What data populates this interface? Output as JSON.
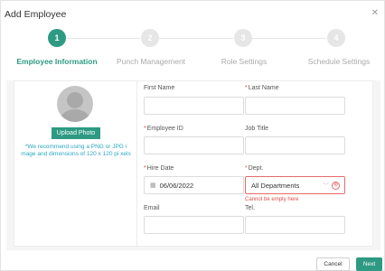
{
  "dialog": {
    "title": "Add Employee",
    "close_icon": "close-icon"
  },
  "steps": [
    {
      "number": "1",
      "label": "Employee Information",
      "active": true
    },
    {
      "number": "2",
      "label": "Punch Management",
      "active": false
    },
    {
      "number": "3",
      "label": "Role Settings",
      "active": false
    },
    {
      "number": "4",
      "label": "Schedule Settings",
      "active": false
    }
  ],
  "photo": {
    "upload_label": "Upload Photo",
    "hint": "*We recommend using a PNG or JPG i mage and dimensions of 120 x 120 pi xels"
  },
  "form": {
    "first_name": {
      "label": "First Name",
      "value": ""
    },
    "last_name": {
      "label": "Last Name",
      "value": "",
      "required": true
    },
    "employee_id": {
      "label": "Employee ID",
      "value": "",
      "required": true
    },
    "job_title": {
      "label": "Job Title",
      "value": ""
    },
    "hire_date": {
      "label": "Hire Date",
      "value": "06/06/2022",
      "required": true
    },
    "dept": {
      "label": "Dept.",
      "value": "All Departments",
      "required": true,
      "error": "Cannot be empty here"
    },
    "email": {
      "label": "Email",
      "value": ""
    },
    "tel": {
      "label": "Tel.",
      "value": ""
    }
  },
  "footer": {
    "cancel_label": "Cancel",
    "next_label": "Next"
  },
  "colors": {
    "accent": "#2e9a83",
    "error": "#e04e4e",
    "hint": "#2aa7c2"
  }
}
